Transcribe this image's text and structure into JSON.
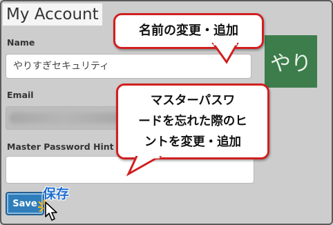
{
  "page": {
    "title": "My Account"
  },
  "form": {
    "name_label": "Name",
    "name_value": "やりすぎセキュリティ",
    "email_label": "Email",
    "hint_label": "Master Password Hint",
    "hint_value": "",
    "save_label": "Save"
  },
  "avatar": {
    "text": "やり",
    "color": "#3c7d4b"
  },
  "annotations": {
    "name_callout": "名前の変更・追加",
    "hint_callout_lines": [
      "マスターパスワ",
      "ードを忘れた際のヒ",
      "ントを変更・追加"
    ],
    "save_note": "保存"
  },
  "colors": {
    "callout_border": "#d11f1f",
    "save_button": "#2f7ebb",
    "annotation_text": "#1f6fd1"
  },
  "icons": {
    "cursor": "mouse-pointer-icon",
    "click": "click-burst-icon"
  }
}
